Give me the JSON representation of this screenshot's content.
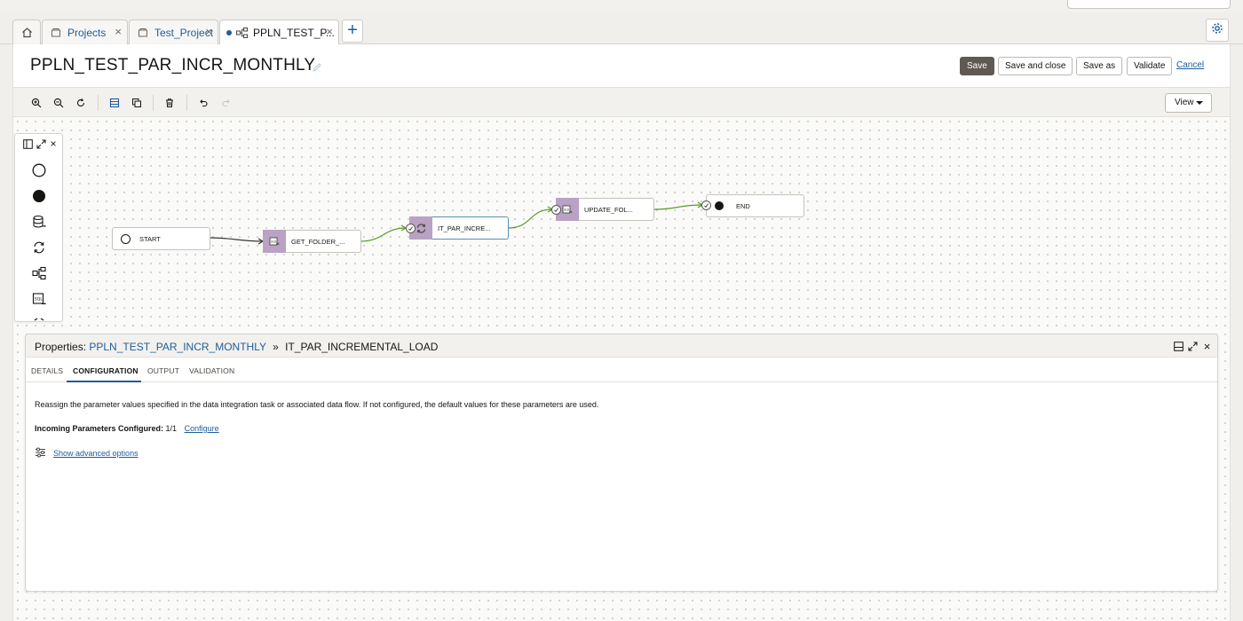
{
  "tabs": [
    {
      "label": "Projects",
      "icon": "project-icon"
    },
    {
      "label": "Test_Project",
      "icon": "project-icon"
    },
    {
      "label": "PPLN_TEST_P...",
      "icon": "pipeline-icon",
      "active": true
    }
  ],
  "header": {
    "title": "PPLN_TEST_PAR_INCR_MONTHLY",
    "buttons": {
      "save": "Save",
      "save_close": "Save and close",
      "save_as": "Save as",
      "validate": "Validate"
    },
    "cancel_label": "Cancel"
  },
  "toolbar": {
    "view_label": "View",
    "icons": [
      "zoom-in-icon",
      "zoom-out-icon",
      "reset-zoom-icon",
      "grid-view-icon",
      "copy-icon",
      "delete-icon",
      "undo-icon",
      "redo-icon"
    ]
  },
  "palette": {
    "items": [
      "start-operator-icon",
      "end-operator-icon",
      "data-loader-icon",
      "integration-task-icon",
      "pipeline-task-icon",
      "sql-task-icon"
    ]
  },
  "pipeline": {
    "nodes": [
      {
        "label": "START"
      },
      {
        "label": "GET_FOLDER_..."
      },
      {
        "label": "IT_PAR_INCRE..."
      },
      {
        "label": "UPDATE_FOL..."
      },
      {
        "label": "END"
      }
    ]
  },
  "properties": {
    "prefix": "Properties:",
    "pipeline_link": "PPLN_TEST_PAR_INCR_MONTHLY",
    "separator": "»",
    "selected": "IT_PAR_INCREMENTAL_LOAD",
    "tabs": [
      "DETAILS",
      "CONFIGURATION",
      "OUTPUT",
      "VALIDATION"
    ],
    "active_tab": "CONFIGURATION",
    "description": "Reassign the parameter values specified in the data integration task or associated data flow. If not configured, the default values for these parameters are used.",
    "params_label": "Incoming Parameters Configured:",
    "params_value": "1/1",
    "configure_link": "Configure",
    "advanced_link": "Show advanced options"
  },
  "colors": {
    "accent": "#1f5d9a",
    "primary_button": "#5f5954",
    "task_icon_bg": "#b9a2c4",
    "success_link": "#5a9a2a"
  }
}
